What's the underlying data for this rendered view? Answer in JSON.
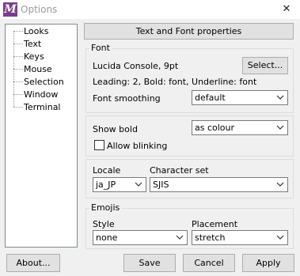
{
  "window": {
    "title": "Options",
    "app_icon_letter": "M",
    "close_glyph": "✕"
  },
  "tree": {
    "items": [
      "Looks",
      "Text",
      "Keys",
      "Mouse",
      "Selection",
      "Window",
      "Terminal"
    ]
  },
  "header": {
    "title": "Text and Font properties"
  },
  "font_group": {
    "label": "Font",
    "font_name": "Lucida Console, 9pt",
    "select_button": "Select...",
    "info": "Leading: 2, Bold: font, Underline: font",
    "smoothing_label": "Font smoothing",
    "smoothing_value": "default"
  },
  "bold_group": {
    "show_bold_label": "Show bold",
    "show_bold_value": "as colour",
    "allow_blinking_label": "Allow blinking",
    "allow_blinking_checked": false
  },
  "locale_group": {
    "locale_label": "Locale",
    "locale_value": "ja_JP",
    "charset_label": "Character set",
    "charset_value": "SJIS"
  },
  "emojis_group": {
    "label": "Emojis",
    "style_label": "Style",
    "style_value": "none",
    "placement_label": "Placement",
    "placement_value": "stretch"
  },
  "buttons": {
    "about": "About...",
    "save": "Save",
    "cancel": "Cancel",
    "apply": "Apply"
  },
  "icons": {
    "app": "mintty-icon",
    "close": "close-icon",
    "dropdown": "chevron-down-icon",
    "checkbox": "checkbox-icon"
  }
}
